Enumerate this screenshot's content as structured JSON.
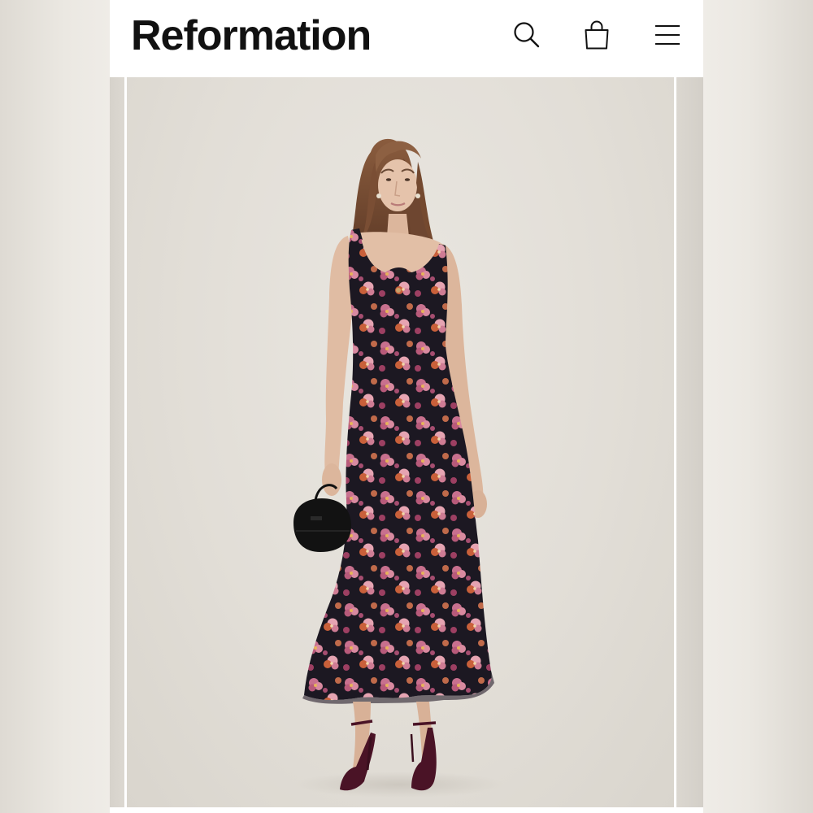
{
  "header": {
    "logo_text": "Reformation",
    "icons": [
      "search-icon",
      "shopping-bag-icon",
      "menu-icon"
    ]
  },
  "gallery": {
    "slides": [
      "previous-product-image",
      "product-image",
      "next-product-image"
    ]
  },
  "colors": {
    "header_bg": "#ffffff",
    "logo": "#111111",
    "backdrop": "#e3dfd8",
    "dress_base": "#1c1822",
    "dress_flower_pink": "#c8708e",
    "dress_flower_light": "#e6a4b2",
    "dress_flower_orange": "#c9603a",
    "shoes": "#4a1326",
    "bag": "#121212",
    "hair": "#7a4e34",
    "skin": "#e5c3ab"
  }
}
